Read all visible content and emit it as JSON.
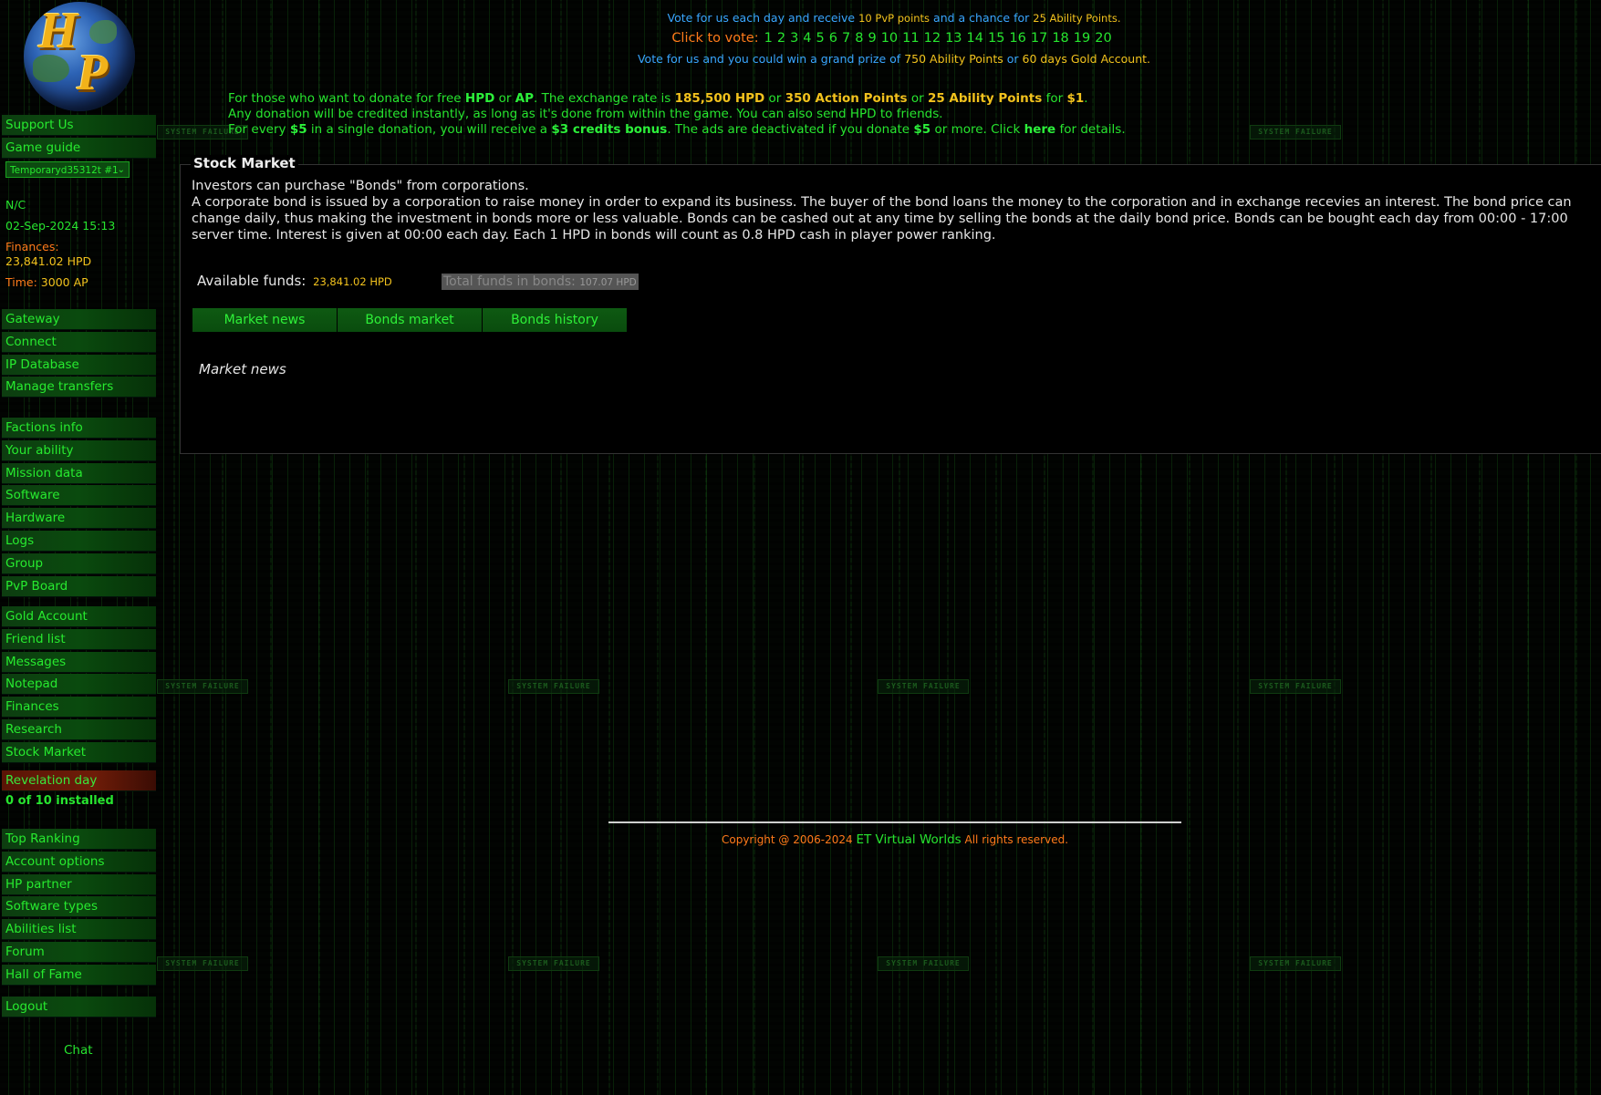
{
  "vote": {
    "line1_pre": "Vote for us each day and receive",
    "line1_pvp": "10 PvP points",
    "line1_mid": "and a chance for",
    "line1_ability": "25 Ability Points.",
    "click_label": "Click to vote:",
    "numbers": [
      "1",
      "2",
      "3",
      "4",
      "5",
      "6",
      "7",
      "8",
      "9",
      "10",
      "11",
      "12",
      "13",
      "14",
      "15",
      "16",
      "17",
      "18",
      "19",
      "20"
    ],
    "line3_pre": "Vote for us and you could win a grand prize of",
    "line3_prize": "750 Ability Points",
    "line3_or": "or",
    "line3_gold": "60 days Gold Account."
  },
  "donate": {
    "l1_a": "For those who want to donate for free",
    "l1_hpd": "HPD",
    "l1_or": "or",
    "l1_ap": "AP",
    "l1_b": ". The exchange rate is",
    "l1_rate1": "185,500 HPD",
    "l1_or2": "or",
    "l1_rate2": "350 Action Points",
    "l1_or3": "or",
    "l1_rate3": "25 Ability Points",
    "l1_for": "for",
    "l1_usd": "$1",
    "l2": "Any donation will be credited instantly, as long as it's done from within the game. You can also send HPD to friends.",
    "l3_a": "For every",
    "l3_usd1": "$5",
    "l3_b": "in a single donation, you will receive a",
    "l3_bonus": "$3 credits bonus",
    "l3_c": ". The ads are deactivated if you donate",
    "l3_usd2": "$5",
    "l3_d": "or more. Click",
    "l3_here": "here",
    "l3_e": "for details."
  },
  "sidebar": {
    "support": "Support Us",
    "guide": "Game guide",
    "account_select": "Temporaryd35312t #1",
    "status": "N/C",
    "datetime": "02-Sep-2024 15:13",
    "finances_label": "Finances:",
    "finances_value": "23,841.02 HPD",
    "time_label": "Time:",
    "time_value": "3000 AP",
    "group1": [
      "Gateway",
      "Connect",
      "IP Database",
      "Manage transfers"
    ],
    "group2": [
      "Factions info",
      "Your ability",
      "Mission data",
      "Software",
      "Hardware",
      "Logs",
      "Group",
      "PvP Board"
    ],
    "group3": [
      "Gold Account",
      "Friend list",
      "Messages",
      "Notepad",
      "Finances",
      "Research",
      "Stock Market"
    ],
    "revelation": "Revelation day",
    "installed": "0 of 10 installed",
    "group4": [
      "Top Ranking",
      "Account options",
      "HP partner",
      "Software types",
      "Abilities list",
      "Forum",
      "Hall of Fame"
    ],
    "logout": "Logout",
    "chat": "Chat"
  },
  "panel": {
    "title": "Stock Market",
    "desc1": "Investors can purchase \"Bonds\" from corporations.",
    "desc2": "A corporate bond is issued by a corporation to raise money in order to expand its business. The buyer of the bond loans the money to the corporation and in exchange recevies an interest. The bond price can change daily, thus making the investment in bonds more or less valuable. Bonds can be cashed out at any time by selling the bonds at the daily bond price. Bonds can be bought each day from 00:00 - 17:00 server time. Interest is given at 00:00 each day. Each 1 HPD in bonds will count as 0.8 HPD cash in player power ranking.",
    "available_label": "Available funds:",
    "available_value": "23,841.02 HPD",
    "bonds_label": "Total funds in bonds:",
    "bonds_value": "107.07 HPD",
    "tabs": [
      "Market news",
      "Bonds market",
      "Bonds history"
    ],
    "news_title": "Market news"
  },
  "footer": {
    "copyright": "Copyright @ 2006-2024",
    "company": "ET Virtual Worlds",
    "rights": "All rights reserved."
  },
  "decor": {
    "watermark": "SYSTEM FAILURE"
  }
}
